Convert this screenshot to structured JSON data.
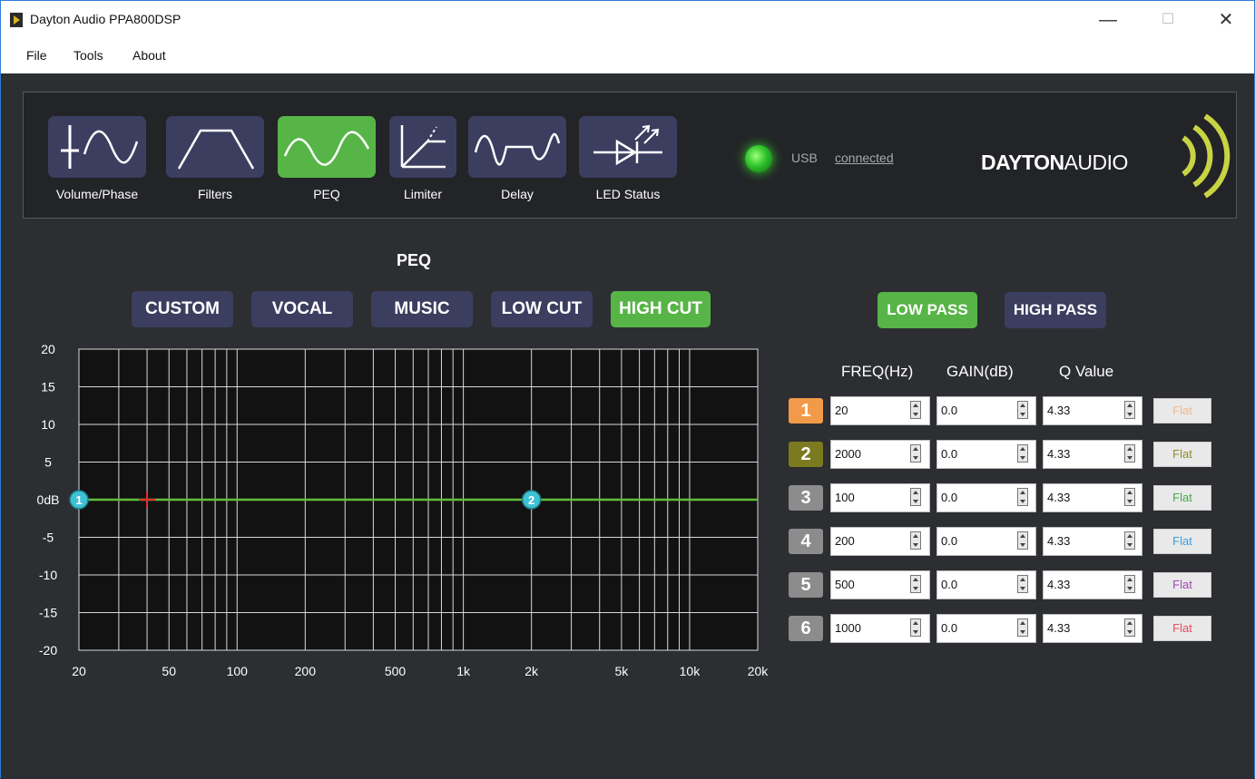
{
  "window": {
    "title": "Dayton Audio PPA800DSP",
    "minimize": "—",
    "maximize": "☐",
    "close": "✕"
  },
  "menu": [
    "File",
    "Tools",
    "About"
  ],
  "toolbar": {
    "tools": [
      {
        "label": "Volume/Phase",
        "icon": "volume-phase-icon",
        "active": false
      },
      {
        "label": "Filters",
        "icon": "filters-icon",
        "active": false
      },
      {
        "label": "PEQ",
        "icon": "peq-icon",
        "active": true
      },
      {
        "label": "Limiter",
        "icon": "limiter-icon",
        "active": false
      },
      {
        "label": "Delay",
        "icon": "delay-icon",
        "active": false
      },
      {
        "label": "LED Status",
        "icon": "led-status-icon",
        "active": false
      }
    ],
    "usb_label": "USB",
    "usb_status": "connected",
    "logo_bold": "DAYTON",
    "logo_thin": "AUDIO"
  },
  "peq": {
    "title": "PEQ",
    "presets": [
      {
        "label": "CUSTOM",
        "active": false
      },
      {
        "label": "VOCAL",
        "active": false
      },
      {
        "label": "MUSIC",
        "active": false
      },
      {
        "label": "LOW CUT",
        "active": false
      },
      {
        "label": "HIGH CUT",
        "active": true
      }
    ],
    "pass_buttons": [
      {
        "label": "LOW PASS",
        "active": true
      },
      {
        "label": "HIGH PASS",
        "active": false
      }
    ],
    "columns": [
      "FREQ(Hz)",
      "GAIN(dB)",
      "Q Value"
    ],
    "bands": [
      {
        "num": "1",
        "freq": "20",
        "gain": "0.0",
        "q": "4.33",
        "flat": "Flat",
        "color": "#f39a4a",
        "flat_color": "#f2b88a"
      },
      {
        "num": "2",
        "freq": "2000",
        "gain": "0.0",
        "q": "4.33",
        "flat": "Flat",
        "color": "#7c7a1e",
        "flat_color": "#8f8d2a"
      },
      {
        "num": "3",
        "freq": "100",
        "gain": "0.0",
        "q": "4.33",
        "flat": "Flat",
        "color": "#8c8c8c",
        "flat_color": "#47a84a"
      },
      {
        "num": "4",
        "freq": "200",
        "gain": "0.0",
        "q": "4.33",
        "flat": "Flat",
        "color": "#8c8c8c",
        "flat_color": "#3b9de0"
      },
      {
        "num": "5",
        "freq": "500",
        "gain": "0.0",
        "q": "4.33",
        "flat": "Flat",
        "color": "#8c8c8c",
        "flat_color": "#a347b8"
      },
      {
        "num": "6",
        "freq": "1000",
        "gain": "0.0",
        "q": "4.33",
        "flat": "Flat",
        "color": "#8c8c8c",
        "flat_color": "#e84a5f"
      }
    ]
  },
  "chart_data": {
    "type": "line",
    "x_scale": "log",
    "xlim": [
      20,
      20000
    ],
    "ylim": [
      -20,
      20
    ],
    "x_ticks": [
      {
        "label": "20",
        "value": 20
      },
      {
        "label": "50",
        "value": 50
      },
      {
        "label": "100",
        "value": 100
      },
      {
        "label": "200",
        "value": 200
      },
      {
        "label": "500",
        "value": 500
      },
      {
        "label": "1k",
        "value": 1000
      },
      {
        "label": "2k",
        "value": 2000
      },
      {
        "label": "5k",
        "value": 5000
      },
      {
        "label": "10k",
        "value": 10000
      },
      {
        "label": "20k",
        "value": 20000
      }
    ],
    "y_ticks": [
      {
        "label": "20",
        "value": 20
      },
      {
        "label": "15",
        "value": 15
      },
      {
        "label": "10",
        "value": 10
      },
      {
        "label": "5",
        "value": 5
      },
      {
        "label": "0dB",
        "value": 0
      },
      {
        "label": "-5",
        "value": -5
      },
      {
        "label": "-10",
        "value": -10
      },
      {
        "label": "-15",
        "value": -15
      },
      {
        "label": "-20",
        "value": -20
      }
    ],
    "grid": true,
    "response": {
      "x": [
        20,
        20000
      ],
      "y": [
        0,
        0
      ],
      "color": "#5fbf3a"
    },
    "markers": [
      {
        "label": "1",
        "x": 20,
        "y": 0
      },
      {
        "label": "2",
        "x": 2000,
        "y": 0
      }
    ],
    "cursor": {
      "x": 40,
      "y": 0
    }
  }
}
